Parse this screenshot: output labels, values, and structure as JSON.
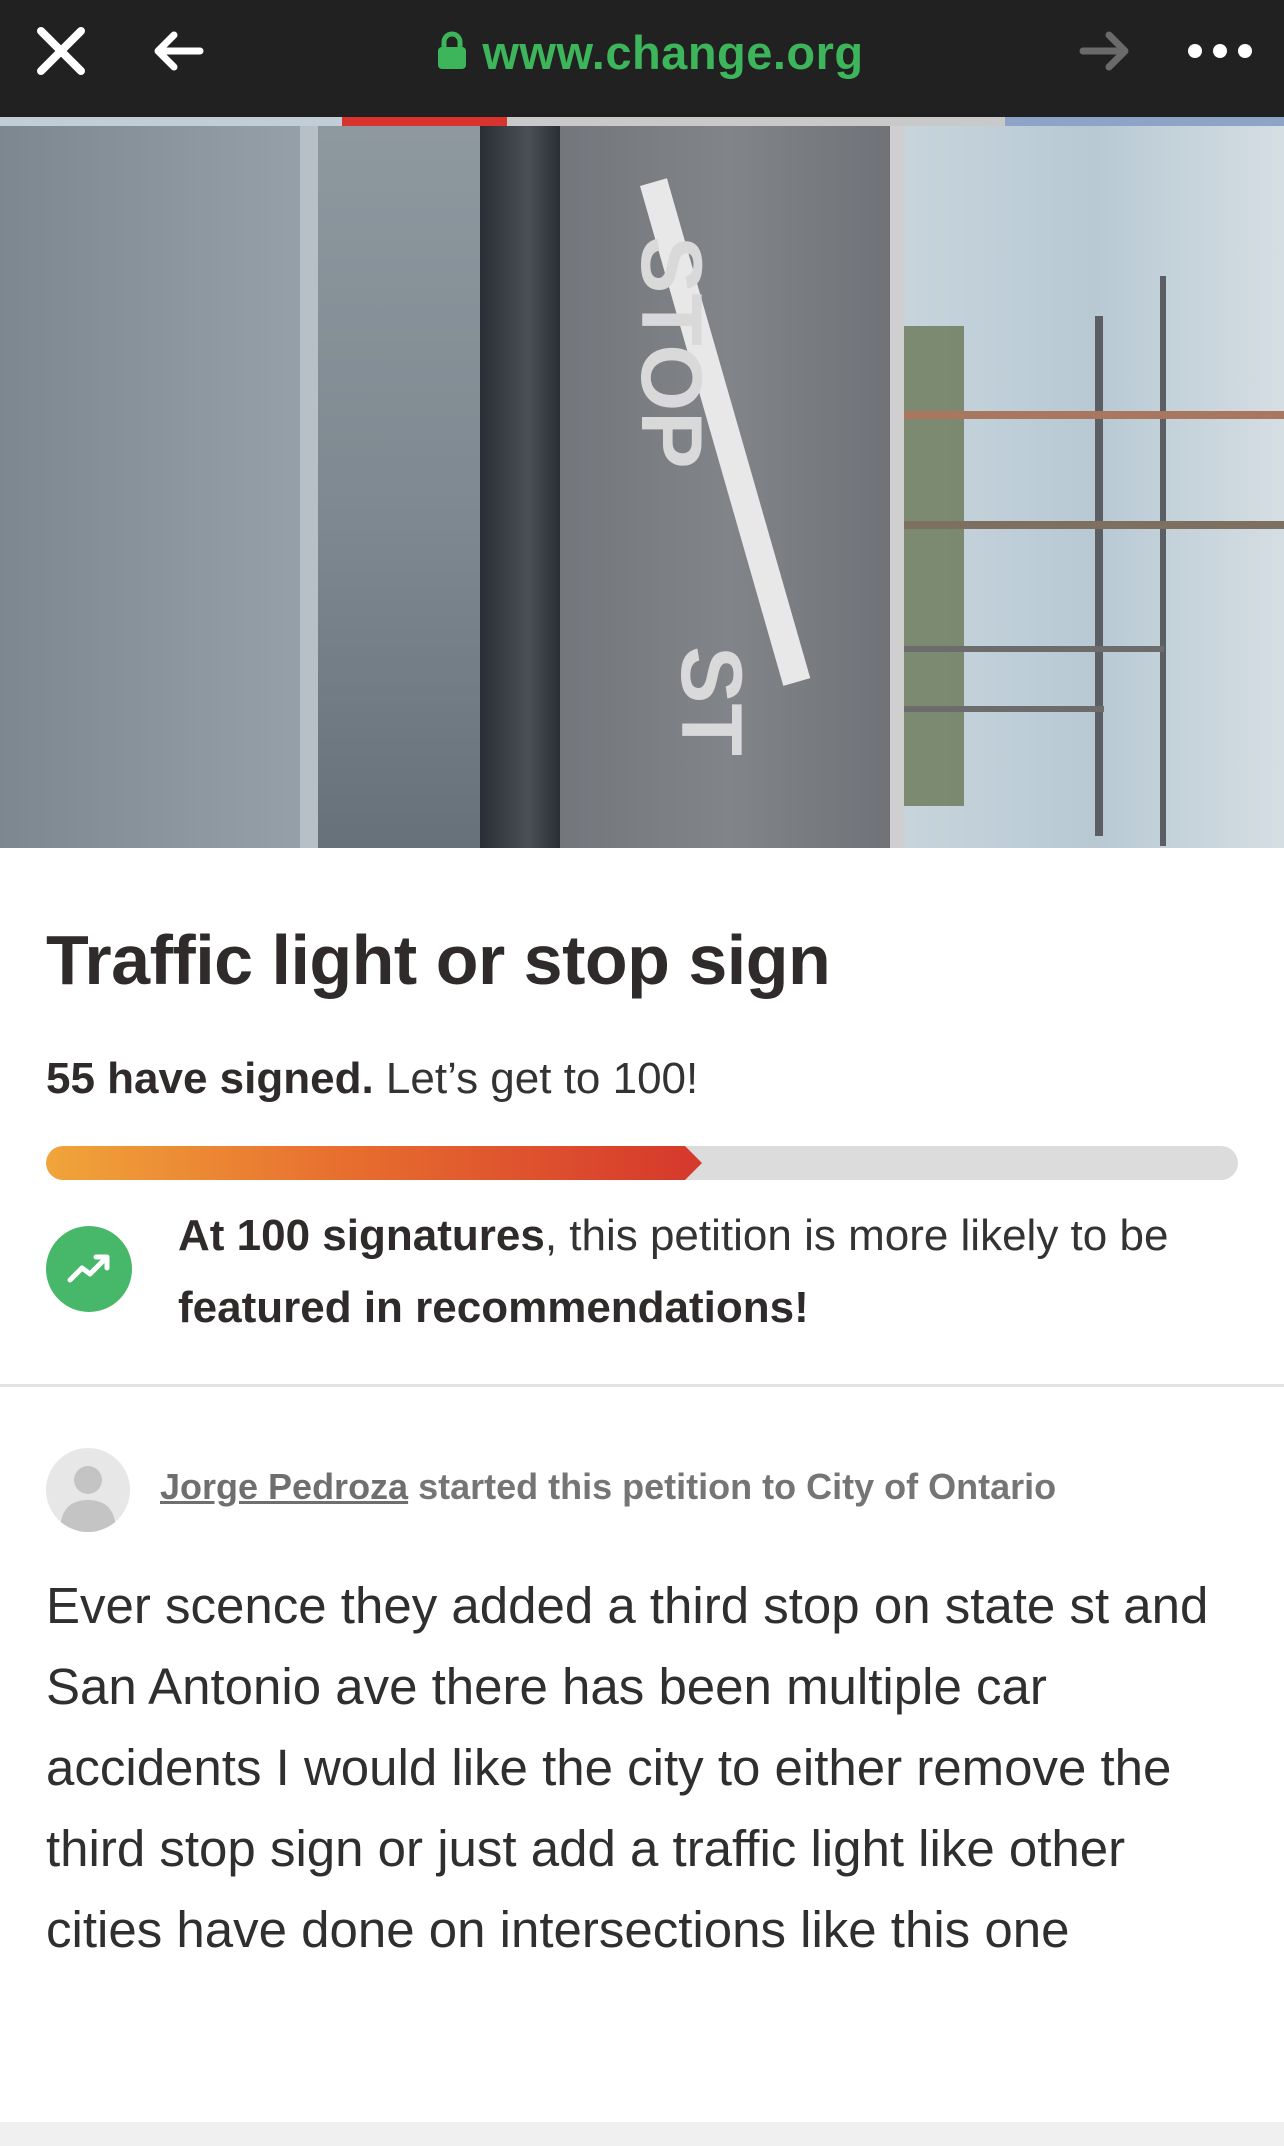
{
  "browser": {
    "url": "www.change.org",
    "icons": {
      "close": "close-icon",
      "back": "arrow-left-icon",
      "lock": "lock-icon",
      "forward": "arrow-right-icon",
      "more": "more-dots-icon"
    },
    "url_color": "#3db55a"
  },
  "hero": {
    "image": "street intersection photo with stop markings and railroad crossing"
  },
  "petition": {
    "title": "Traffic light or stop sign",
    "signed_count_text": "55 have signed.",
    "signed_goal_text": " Let’s get to 100!",
    "progress": {
      "signed": 55,
      "goal": 100,
      "fraction": 0.55
    },
    "milestone": {
      "icon": "trending-up-icon",
      "bold1": "At 100 signatures",
      "text1": ", this petition is more likely to be ",
      "bold2": "featured in recommendations!"
    },
    "starter": {
      "author": "Jorge Pedroza",
      "rest": " started this petition to City of Ontario",
      "avatar": "user-avatar-icon"
    },
    "description": "Ever scence they added a third stop on state st and San Antonio ave there has been multiple car accidents I would like the city to either remove the third stop sign or just add a traffic light like other cities have done on intersections like this one"
  },
  "colors": {
    "accent_green": "#47b86a",
    "progress_start": "#f0a53a",
    "progress_end": "#d63a2c",
    "topbar_bg": "#212121"
  }
}
